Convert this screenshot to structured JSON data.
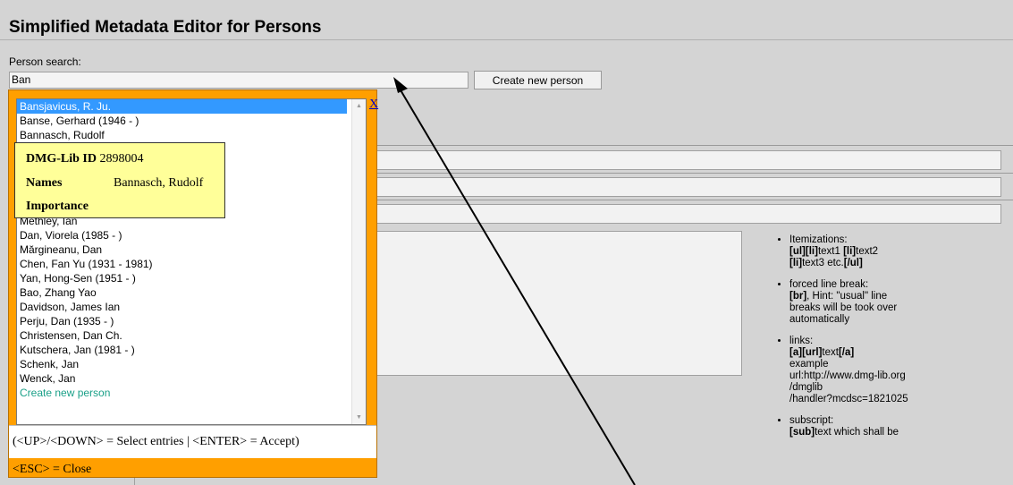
{
  "header": {
    "title": "Simplified Metadata Editor for Persons"
  },
  "search": {
    "label": "Person search:",
    "value": "Ban",
    "create_button": "Create new person"
  },
  "popup": {
    "close_label": "X",
    "items": [
      {
        "label": "Bansjavicus, R. Ju.",
        "selected": true
      },
      {
        "label": "Banse, Gerhard (1946 - )"
      },
      {
        "label": "Bannasch, Rudolf"
      },
      {
        "label": ""
      },
      {
        "label": ""
      },
      {
        "label": ""
      },
      {
        "label": ""
      },
      {
        "label": ""
      },
      {
        "label": "Methley, Ian"
      },
      {
        "label": "Dan, Viorela (1985 - )"
      },
      {
        "label": "Mărgineanu, Dan"
      },
      {
        "label": "Chen, Fan Yu (1931 - 1981)"
      },
      {
        "label": "Yan, Hong-Sen (1951 - )"
      },
      {
        "label": "Bao, Zhang Yao"
      },
      {
        "label": "Davidson, James Ian"
      },
      {
        "label": "Perju, Dan (1935 - )"
      },
      {
        "label": "Christensen, Dan Ch."
      },
      {
        "label": "Kutschera, Jan (1981 - )"
      },
      {
        "label": "Schenk, Jan"
      },
      {
        "label": "Wenck, Jan"
      },
      {
        "label": "Create new person",
        "create": true
      }
    ],
    "hint": "(<UP>/<DOWN> = Select entries | <ENTER> = Accept)",
    "esc_hint": "<ESC> = Close"
  },
  "tooltip": {
    "id_label": "DMG-Lib ID",
    "id_value": "2898004",
    "names_label": "Names",
    "names_value": "Bannasch, Rudolf",
    "importance_label": "Importance"
  },
  "help": {
    "itemizations_title": "Itemizations:",
    "itemizations_l1_a": "[ul][li]",
    "itemizations_l1_b": "text1 ",
    "itemizations_l1_c": "[li]",
    "itemizations_l1_d": "text2",
    "itemizations_l2_a": "[li]",
    "itemizations_l2_b": "text3 etc.",
    "itemizations_l2_c": "[/ul]",
    "break_title": "forced line break:",
    "break_l1_a": "[br]",
    "break_l1_b": ", Hint: \"usual\" line",
    "break_l2": "breaks will be took over",
    "break_l3": "automatically",
    "links_title": "links:",
    "links_l1_a": "[a]",
    "links_l1_b": "[url]",
    "links_l1_c": "text",
    "links_l1_d": "[/a]",
    "links_l2": "example",
    "links_l3": "url:http://www.dmg-lib.org",
    "links_l4": "/dmglib",
    "links_l5": "/handler?mcdsc=1821025",
    "sub_title": "subscript:",
    "sub_l1_a": "[sub]",
    "sub_l1_b": "text which shall be"
  }
}
